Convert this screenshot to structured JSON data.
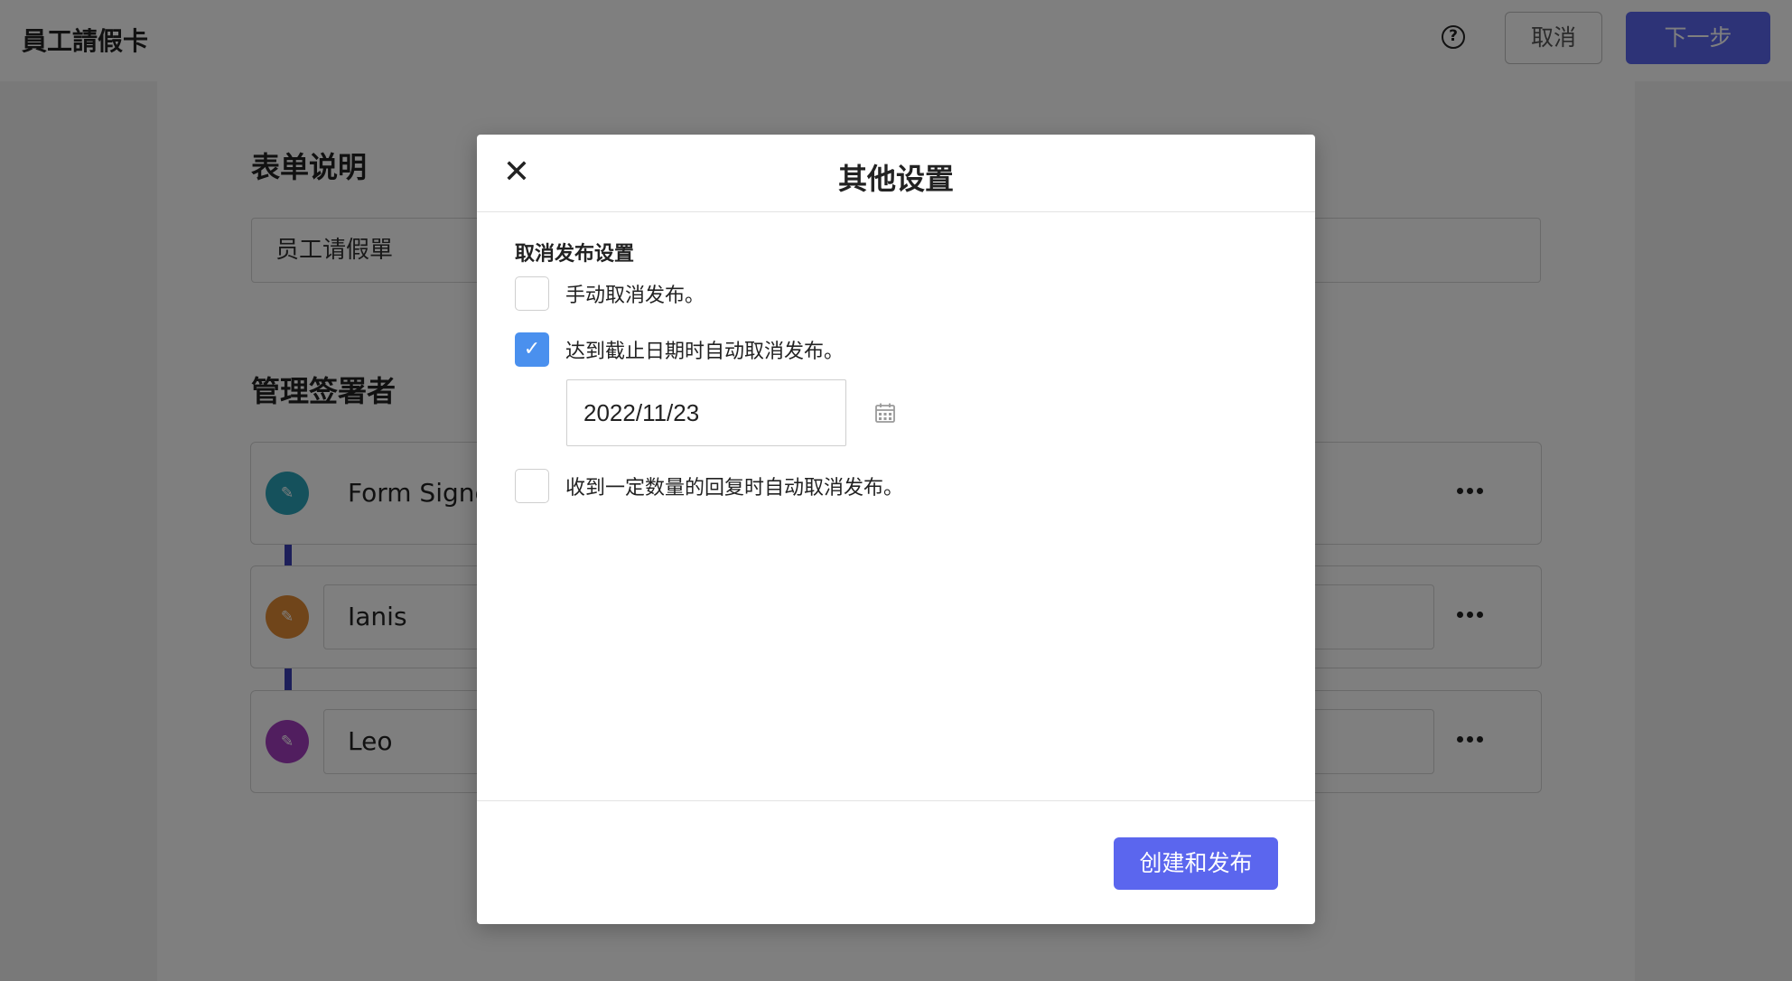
{
  "header": {
    "title": "員工請假卡",
    "help_icon": "question-circle-icon",
    "cancel_label": "取消",
    "next_label": "下一步"
  },
  "form_description": {
    "section_title": "表单说明",
    "value": "员工请假單"
  },
  "signers": {
    "section_title": "管理签署者",
    "items": [
      {
        "name": "Form Signer",
        "avatar_color": "#2aa3b8",
        "icon": "pen-icon"
      },
      {
        "name": "Ianis",
        "avatar_color": "#e08a35",
        "icon": "pen-icon"
      },
      {
        "name": "Leo",
        "avatar_color": "#a23dbf",
        "icon": "pen-icon"
      }
    ],
    "more_icon": "more-horizontal-icon"
  },
  "modal": {
    "title": "其他设置",
    "close_icon": "close-icon",
    "group_label": "取消发布设置",
    "options": [
      {
        "label": "手动取消发布。",
        "checked": false
      },
      {
        "label": "达到截止日期时自动取消发布。",
        "checked": true
      },
      {
        "label": "收到一定数量的回复时自动取消发布。",
        "checked": false
      }
    ],
    "date_value": "2022/11/23",
    "calendar_icon": "calendar-icon",
    "publish_label": "创建和发布"
  },
  "colors": {
    "accent": "#5b66ee",
    "checkbox_checked": "#4a90ee",
    "connector": "#3a3fb4"
  }
}
